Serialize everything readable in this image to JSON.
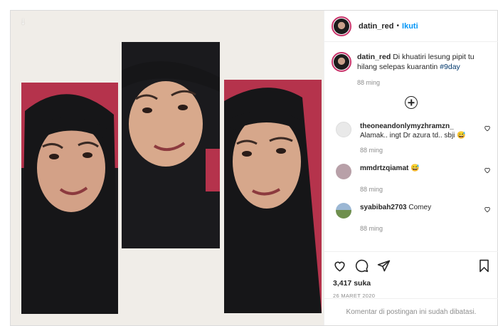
{
  "post": {
    "download_icon": "arrow-down-icon",
    "user": {
      "username": "datin_red",
      "separator": "•",
      "follow_label": "Ikuti"
    },
    "caption": {
      "username": "datin_red",
      "text": "Di khuatiri lesung pipit tu hilang selepas kuarantin",
      "hashtag": "#9day",
      "time": "88 ming"
    },
    "load_more_icon": "plus-circle-icon",
    "comments": [
      {
        "username": "theoneandonlymyzhramzn_",
        "text": "Alamak.. ingt Dr azura td.. sbji 😅",
        "time": "88 ming",
        "avatar_color": "#e9e9e9"
      },
      {
        "username": "mmdrtzqiamat",
        "text": "😅",
        "time": "88 ming",
        "avatar_color": "#b8a0a8"
      },
      {
        "username": "syabibah2703",
        "text": "Comey",
        "time": "88 ming",
        "avatar_color": "#7a9a5c"
      }
    ],
    "actions": {
      "like_icon": "heart-icon",
      "comment_icon": "comment-icon",
      "share_icon": "send-icon",
      "save_icon": "bookmark-icon"
    },
    "likes": "3,417 suka",
    "date": "26 MARET 2020",
    "comments_disabled": "Komentar di postingan ini sudah dibatasi."
  },
  "colors": {
    "follow": "#0095f6",
    "hashtag": "#00376b",
    "muted": "#8e8e8e",
    "story_ring": "#c8336a"
  }
}
